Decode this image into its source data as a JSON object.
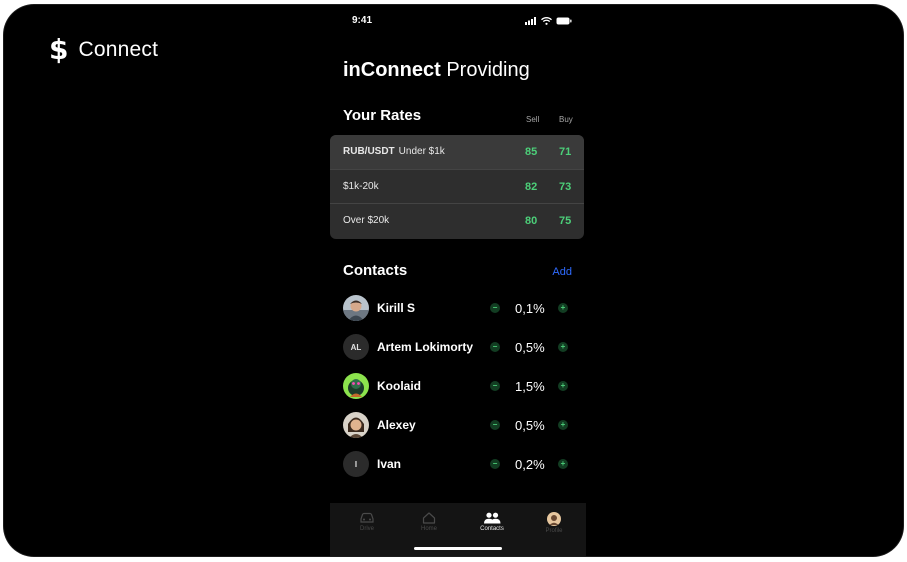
{
  "brand": {
    "symbol": "$",
    "name": "Connect"
  },
  "status_bar": {
    "time": "9:41"
  },
  "title": {
    "bold": "inConnect",
    "rest": "Providing"
  },
  "rates": {
    "title": "Your Rates",
    "sell_label": "Sell",
    "buy_label": "Buy",
    "rows": [
      {
        "pair": "RUB/USDT",
        "range": "Under $1k",
        "sell": "85",
        "buy": "71"
      },
      {
        "pair": "",
        "range": "$1k-20k",
        "sell": "82",
        "buy": "73"
      },
      {
        "pair": "",
        "range": "Over $20k",
        "sell": "80",
        "buy": "75"
      }
    ]
  },
  "contacts": {
    "title": "Contacts",
    "add_label": "Add",
    "items": [
      {
        "name": "Kirill S",
        "percent": "0,1%",
        "avatar": "photo"
      },
      {
        "name": "Artem Lokimorty",
        "percent": "0,5%",
        "avatar": "initials",
        "initials": "AL"
      },
      {
        "name": "Koolaid",
        "percent": "1,5%",
        "avatar": "illustration"
      },
      {
        "name": "Alexey",
        "percent": "0,5%",
        "avatar": "photo"
      },
      {
        "name": "Ivan",
        "percent": "0,2%",
        "avatar": "initials",
        "initials": "I"
      }
    ]
  },
  "tab_bar": {
    "tabs": [
      {
        "label": "Drive",
        "icon": "car-icon"
      },
      {
        "label": "Home",
        "icon": "home-icon"
      },
      {
        "label": "Contacts",
        "icon": "people-icon",
        "active": true
      },
      {
        "label": "Profile",
        "icon": "avatar-icon"
      }
    ]
  },
  "colors": {
    "accent_green": "#4ccf79",
    "link_blue": "#2f6bff",
    "background": "#000000"
  }
}
